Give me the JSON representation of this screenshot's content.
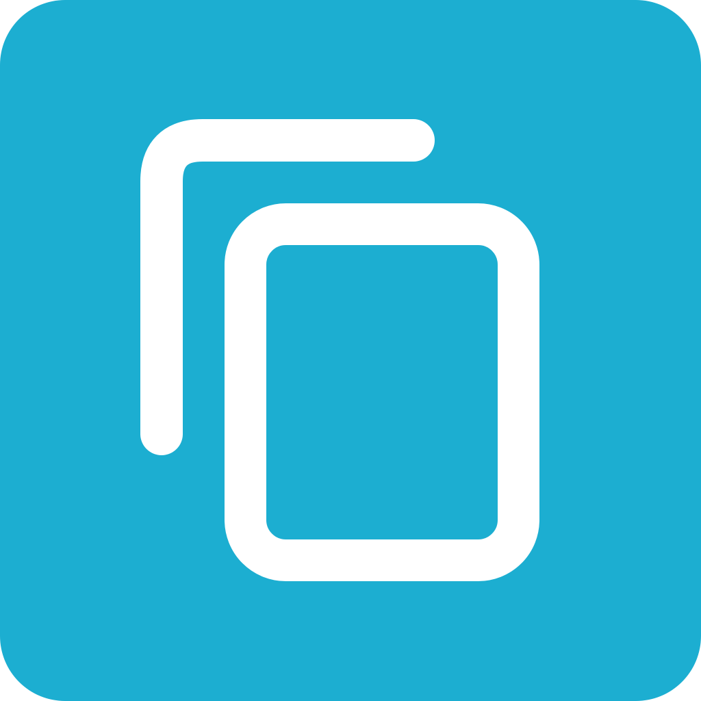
{
  "icon": {
    "name": "copy-icon",
    "background_color": "#1CAED1",
    "glyph_color": "#FFFFFF"
  }
}
